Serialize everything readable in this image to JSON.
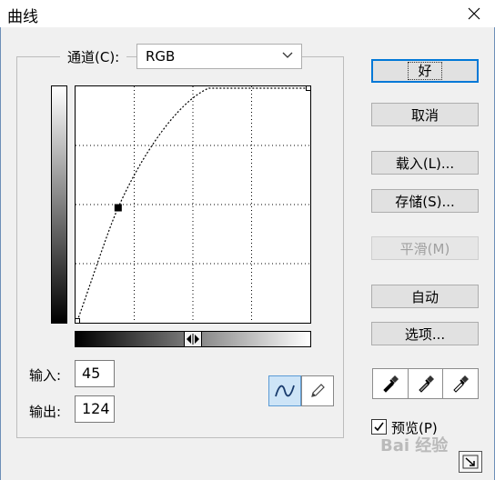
{
  "window": {
    "title": "曲线"
  },
  "channel": {
    "label": "通道(C):",
    "label_underline": "C",
    "value": "RGB"
  },
  "io": {
    "input_label": "输入:",
    "input_value": "45",
    "output_label": "输出:",
    "output_value": "124"
  },
  "buttons": {
    "ok": "好",
    "cancel": "取消",
    "load": "载入(L)...",
    "save": "存储(S)...",
    "smooth": "平滑(M)",
    "auto": "自动",
    "options": "选项..."
  },
  "preview": {
    "label": "预览(P)",
    "checked": true
  },
  "watermark": "Bai 经验",
  "curve": {
    "control_points": [
      {
        "input": 0,
        "output": 0
      },
      {
        "input": 45,
        "output": 124
      },
      {
        "input": 255,
        "output": 255
      }
    ],
    "grid_divisions": 4
  },
  "icons": {
    "close": "close-icon",
    "chevron": "chevron-down-icon",
    "curve_tool": "curve-tool-icon",
    "pencil_tool": "pencil-tool-icon",
    "black_dropper": "black-eyedropper-icon",
    "gray_dropper": "gray-eyedropper-icon",
    "white_dropper": "white-eyedropper-icon",
    "expand": "expand-icon"
  }
}
